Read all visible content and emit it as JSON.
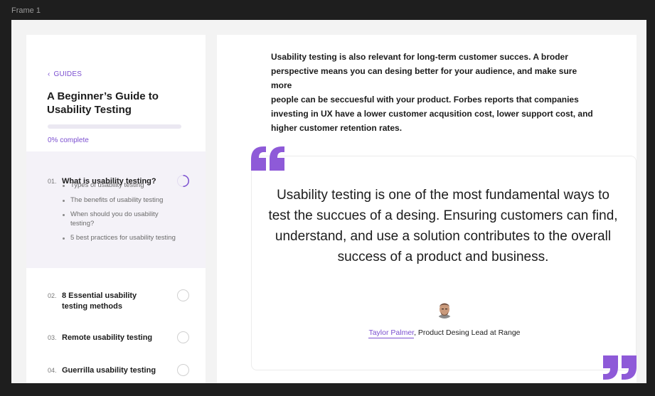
{
  "frame": {
    "label": "Frame 1"
  },
  "sidebar": {
    "back_label": "GUIDES",
    "title": "A Beginner’s Guide to Usability Testing",
    "progress": {
      "value": 0,
      "label": "0% complete"
    },
    "chapters": [
      {
        "number": "01.",
        "title": "What is usability testing?",
        "status": "in-progress",
        "subitems": [
          "Types of usability testing",
          "The benefits of usability testing",
          "When should you do usability testing?",
          "5 best practices for usability testing"
        ]
      },
      {
        "number": "02.",
        "title": "8 Essential usability testing methods",
        "status": "not-started"
      },
      {
        "number": "03.",
        "title": "Remote usability testing",
        "status": "not-started"
      },
      {
        "number": "04.",
        "title": "Guerrilla usability testing",
        "status": "not-started"
      }
    ]
  },
  "main": {
    "intro_lines": [
      "Usability testing is also relevant for long-term customer succes. A broder",
      "perspective means you can desing better for your audience, and make sure",
      "more",
      "people can be seccuesful with your product. Forbes reports that companies",
      "investing in UX have a lower customer acqusition cost, lower support cost, and",
      "higher customer retention rates."
    ],
    "quote": {
      "text": "Usability testing is one of the most fundamental ways to test the succues of a desing. Ensuring customers can  find, understand, and use a solution contributes to the overall success of a product and business.",
      "author": "Taylor Palmer",
      "role": ", Product Desing Lead at Range"
    }
  },
  "colors": {
    "accent": "#7b4fd0",
    "quote_mark": "#8e5ad8",
    "active_chapter_bg": "#f4f2f8",
    "canvas_bg": "#f3f3f3",
    "frame_bg": "#1e1e1e"
  },
  "icons": {
    "back": "chevron-left-icon",
    "quote_open": "quote-open-icon",
    "quote_close": "quote-close-icon",
    "progress_ring": "progress-ring-icon",
    "status_circle": "circle-outline-icon"
  }
}
